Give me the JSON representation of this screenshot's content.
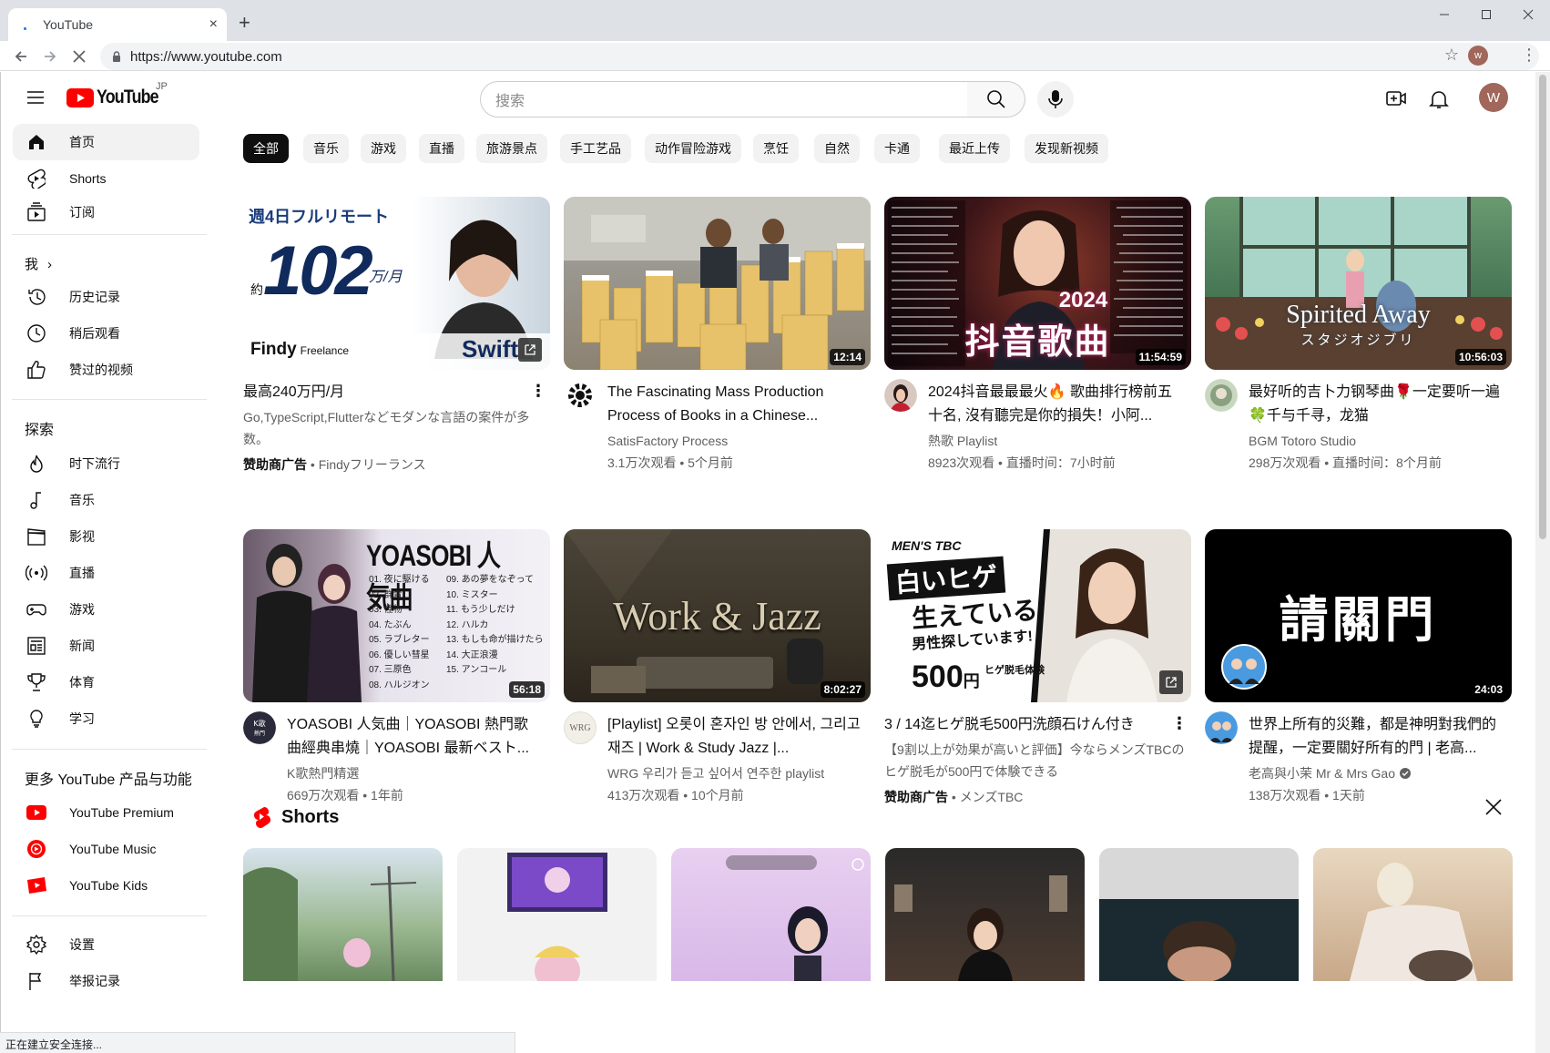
{
  "browser": {
    "tab_title": "YouTube",
    "tab_close": "×",
    "new_tab": "+",
    "url": "https://www.youtube.com",
    "profile_initial": "w",
    "window_controls": [
      "minimize-icon",
      "maximize-icon",
      "close-icon"
    ]
  },
  "masthead": {
    "logo_text": "YouTube",
    "region": "JP",
    "search_placeholder": "搜索",
    "avatar_initial": "W",
    "accent": "#ff0000"
  },
  "sidebar": {
    "main": [
      {
        "label": "首页",
        "icon": "home-icon",
        "active": true
      },
      {
        "label": "Shorts",
        "icon": "shorts-icon"
      },
      {
        "label": "订阅",
        "icon": "subscriptions-icon"
      }
    ],
    "you_heading": "我",
    "you": [
      {
        "label": "历史记录",
        "icon": "history-icon"
      },
      {
        "label": "稍后观看",
        "icon": "watch-later-icon"
      },
      {
        "label": "赞过的视频",
        "icon": "like-icon"
      }
    ],
    "explore_heading": "探索",
    "explore": [
      {
        "label": "时下流行",
        "icon": "trending-icon"
      },
      {
        "label": "音乐",
        "icon": "music-icon"
      },
      {
        "label": "影视",
        "icon": "film-icon"
      },
      {
        "label": "直播",
        "icon": "live-icon"
      },
      {
        "label": "游戏",
        "icon": "gaming-icon"
      },
      {
        "label": "新闻",
        "icon": "news-icon"
      },
      {
        "label": "体育",
        "icon": "sports-icon"
      },
      {
        "label": "学习",
        "icon": "learning-icon"
      }
    ],
    "more_heading": "更多 YouTube 产品与功能",
    "more": [
      {
        "label": "YouTube Premium",
        "icon": "youtube-premium-icon"
      },
      {
        "label": "YouTube Music",
        "icon": "youtube-music-icon"
      },
      {
        "label": "YouTube Kids",
        "icon": "youtube-kids-icon"
      }
    ],
    "settings": [
      {
        "label": "设置",
        "icon": "settings-icon"
      },
      {
        "label": "举报记录",
        "icon": "flag-icon"
      }
    ]
  },
  "chips": [
    "全部",
    "音乐",
    "游戏",
    "直播",
    "旅游景点",
    "手工艺品",
    "动作冒险游戏",
    "烹饪",
    "自然",
    "卡通",
    "最近上传",
    "发现新视频"
  ],
  "videos": [
    {
      "title": "最高240万円/月",
      "line1": "Go,TypeScript,Flutterなどモダンな言語の案件が多数。",
      "sponsor": "赞助商广告",
      "channel": "Findyフリーランス",
      "ad": true,
      "thumb_text": {
        "top": "週4日フルリモート",
        "big": "102",
        "unit": "万/月",
        "pre": "約",
        "brand": "Findy",
        "brand_sub": "Freelance",
        "swift": "Swift"
      }
    },
    {
      "title": "The Fascinating Mass Production Process of Books in a Chinese...",
      "channel": "SatisFactory Process",
      "stats": "3.1万次观看 • 5个月前",
      "duration": "12:14"
    },
    {
      "title": "2024抖音最最最火🔥 歌曲排行榜前五十名, 沒有聽完是你的損失！小阿...",
      "channel": "熱歌 Playlist",
      "stats": "8923次观看 • 直播时间：7小时前",
      "duration": "11:54:59",
      "thumb_text": {
        "year": "2024",
        "big": "抖音歌曲"
      }
    },
    {
      "title": "最好听的吉卜力钢琴曲🌹一定要听一遍🍀千与千寻，龙猫",
      "channel": "BGM Totoro Studio",
      "stats": "298万次观看 • 直播时间：8个月前",
      "duration": "10:56:03",
      "thumb_text": {
        "big": "Spirited Away",
        "sub": "スタジオジブリ"
      }
    },
    {
      "title": "YOASOBI 人気曲｜YOASOBI 熱門歌曲經典串燒｜YOASOBI 最新ベスト...",
      "channel": "K歌熱門精選",
      "stats": "669万次观看 • 1年前",
      "duration": "56:18",
      "thumb_text": {
        "big": "YOASOBI 人気曲",
        "tracks": [
          "01. 夜に駆ける",
          "02. 群青",
          "03. 怪物",
          "04. たぶん",
          "05. ラブレター",
          "06. 優しい彗星",
          "07. 三原色",
          "08. ハルジオン",
          "09. あの夢をなぞって",
          "10. ミスター",
          "11. もう少しだけ",
          "12. ハルカ",
          "13. もしも命が描けたら",
          "14. 大正浪漫",
          "15. アンコール"
        ]
      }
    },
    {
      "title": "[Playlist] 오롯이 혼자인 방 안에서, 그리고 재즈 | Work & Study Jazz |...",
      "channel": "WRG 우리가 듣고 싶어서 연주한 playlist",
      "stats": "413万次观看 • 10个月前",
      "duration": "8:02:27",
      "thumb_text": {
        "big": "Work & Jazz"
      },
      "avatar_text": "WRG"
    },
    {
      "title": "3 / 14迄ヒゲ脱毛500円洗顔石けん付き",
      "line1": "【9割以上が効果が高いと評価】今ならメンズTBCのヒゲ脱毛が500円で体験できる",
      "sponsor": "赞助商广告",
      "channel": "メンズTBC",
      "ad": true,
      "thumb_text": {
        "brand": "MEN'S TBC",
        "l1": "白いヒゲ",
        "l2": "生えている",
        "l3": "男性探しています!",
        "price": "500",
        "yen": "円",
        "tag": "ヒゲ脱毛体験"
      }
    },
    {
      "title": "世界上所有的災難，都是神明對我們的提醒，一定要關好所有的門 | 老高...",
      "channel": "老高與小茉 Mr & Mrs Gao",
      "stats": "138万次观看 • 1天前",
      "duration": "24:03",
      "verified": true,
      "thumb_text": {
        "big": "請關門"
      }
    }
  ],
  "shorts": {
    "label": "Shorts"
  },
  "status_text": "正在建立安全连接..."
}
